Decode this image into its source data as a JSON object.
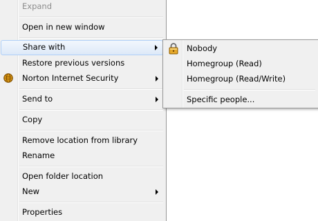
{
  "menu": {
    "items": [
      {
        "label": "Expand",
        "disabled": true
      },
      {
        "label": "Open in new window"
      },
      {
        "label": "Share with",
        "submenu": true,
        "hover": true
      },
      {
        "label": "Restore previous versions"
      },
      {
        "label": "Norton Internet Security",
        "submenu": true,
        "icon": "norton-globe-icon"
      },
      {
        "label": "Send to",
        "submenu": true
      },
      {
        "label": "Copy"
      },
      {
        "label": "Remove location from library"
      },
      {
        "label": "Rename"
      },
      {
        "label": "Open folder location"
      },
      {
        "label": "New",
        "submenu": true
      },
      {
        "label": "Properties"
      }
    ]
  },
  "share_submenu": {
    "items": [
      {
        "label": "Nobody",
        "icon": "lock-icon"
      },
      {
        "label": "Homegroup (Read)"
      },
      {
        "label": "Homegroup (Read/Write)"
      },
      {
        "label": "Specific people..."
      }
    ]
  },
  "colors": {
    "menu_bg": "#f0f0f0",
    "hover_border": "#aecff7",
    "disabled_text": "#8d8d8d"
  }
}
